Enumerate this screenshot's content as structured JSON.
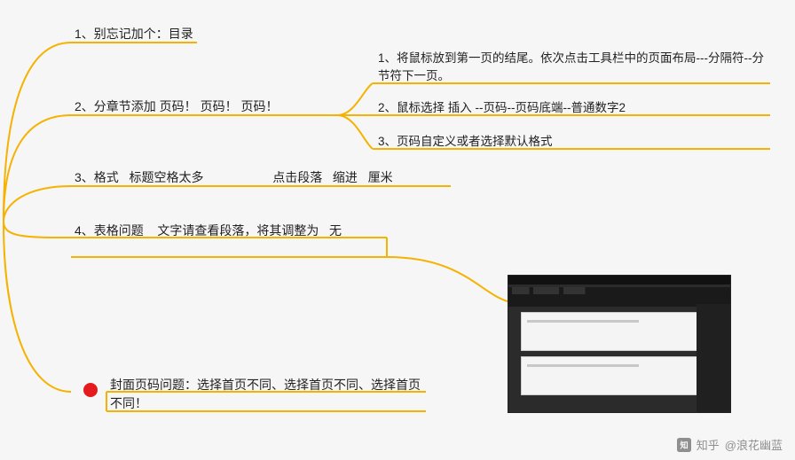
{
  "colors": {
    "connector": "#f5b200",
    "accent_dot": "#e41a1c",
    "text": "#222222"
  },
  "nodes": {
    "n1": "1、别忘记加个：目录",
    "n2": "2、分章节添加 页码！ 页码！ 页码！",
    "n2a": "1、将鼠标放到第一页的结尾。依次点击工具栏中的页面布局---分隔符--分节符下一页。",
    "n2b": "2、鼠标选择 插入 --页码--页码底端--普通数字2",
    "n2c": "3、页码自定义或者选择默认格式",
    "n3": "3、格式   标题空格太多                    点击段落   缩进   厘米",
    "n4": "4、表格问题    文字请查看段落，将其调整为   无",
    "n5": "封面页码问题：选择首页不同、选择首页不同、选择首页不同！"
  },
  "watermark": {
    "platform": "知乎",
    "author": "@浪花幽蓝"
  },
  "thumbnail": {
    "label": "word-page-layout-screenshot"
  }
}
